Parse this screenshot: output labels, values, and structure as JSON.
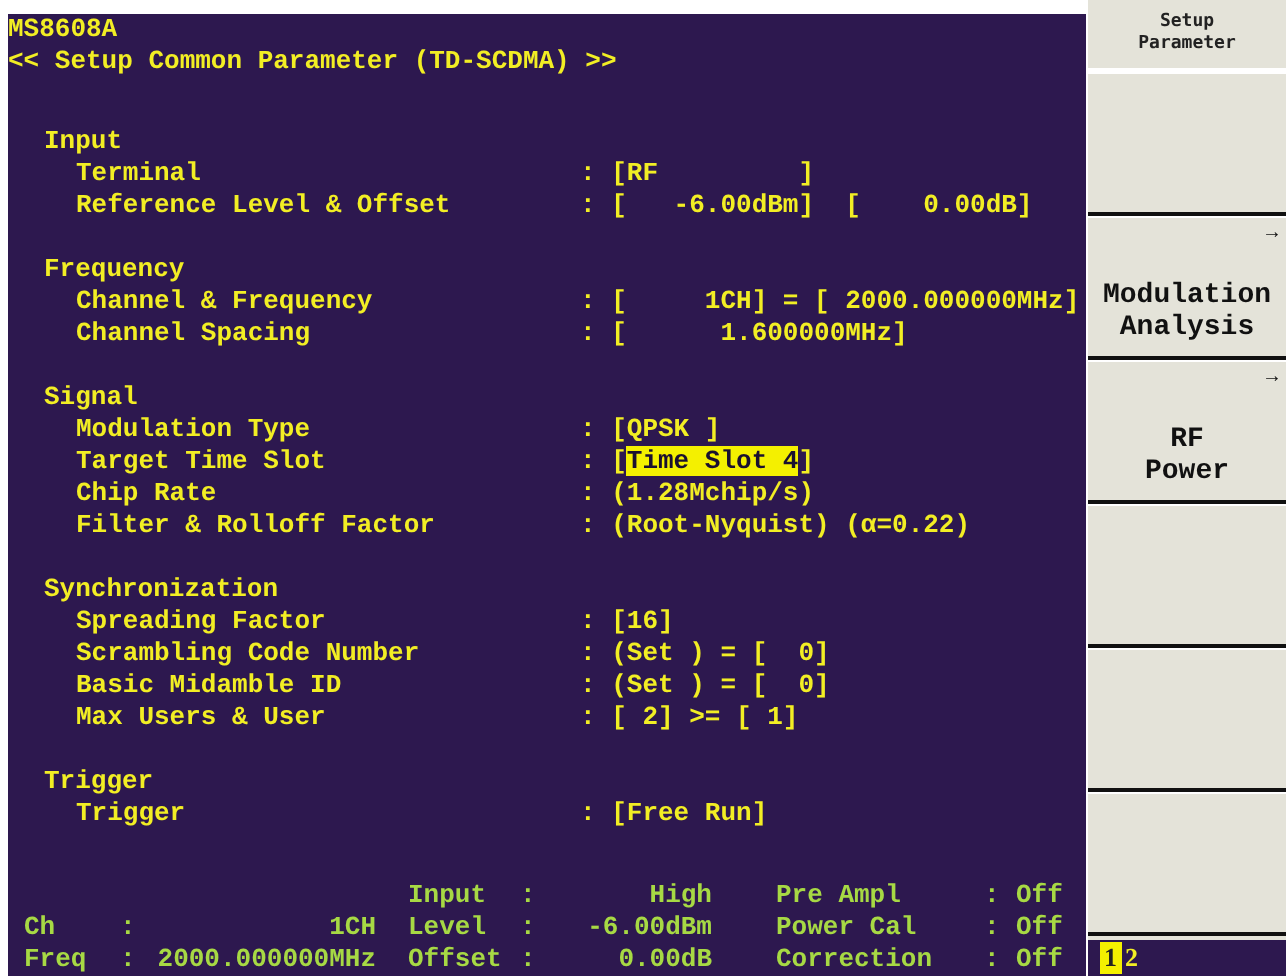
{
  "screen": {
    "model": "MS8608A",
    "title": "<< Setup Common Parameter (TD-SCDMA) >>"
  },
  "sections": [
    {
      "title": "Input",
      "rows": [
        {
          "label": "Terminal",
          "value": [
            {
              "text": ": [RF         ]",
              "selected": false
            }
          ]
        },
        {
          "label": "Reference Level & Offset",
          "value": [
            {
              "text": ": [   -6.00dBm]  [    0.00dB]",
              "selected": false
            }
          ]
        }
      ]
    },
    {
      "title": "Frequency",
      "rows": [
        {
          "label": "Channel & Frequency",
          "value": [
            {
              "text": ": [     1CH] = [ 2000.000000MHz]",
              "selected": false
            }
          ]
        },
        {
          "label": "Channel Spacing",
          "value": [
            {
              "text": ": [      1.600000MHz]",
              "selected": false
            }
          ]
        }
      ]
    },
    {
      "title": "Signal",
      "rows": [
        {
          "label": "Modulation Type",
          "value": [
            {
              "text": ": [QPSK ]",
              "selected": false
            }
          ]
        },
        {
          "label": "Target Time Slot",
          "value": [
            {
              "text": ": [",
              "selected": false
            },
            {
              "text": "Time Slot 4",
              "selected": true
            },
            {
              "text": "]",
              "selected": false
            }
          ]
        },
        {
          "label": "Chip Rate",
          "value": [
            {
              "text": ": (1.28Mchip/s)",
              "selected": false
            }
          ]
        },
        {
          "label": "Filter & Rolloff Factor",
          "value": [
            {
              "text": ": (Root-Nyquist) (α=0.22)",
              "selected": false
            }
          ]
        }
      ]
    },
    {
      "title": "Synchronization",
      "rows": [
        {
          "label": "Spreading Factor",
          "value": [
            {
              "text": ": [16]",
              "selected": false
            }
          ]
        },
        {
          "label": "Scrambling Code Number",
          "value": [
            {
              "text": ": (Set ) = [  0]",
              "selected": false
            }
          ]
        },
        {
          "label": "Basic Midamble ID",
          "value": [
            {
              "text": ": (Set ) = [  0]",
              "selected": false
            }
          ]
        },
        {
          "label": "Max Users & User",
          "value": [
            {
              "text": ": [ 2] >= [ 1]",
              "selected": false
            }
          ]
        }
      ]
    },
    {
      "title": "Trigger",
      "rows": [
        {
          "label": "Trigger",
          "value": [
            {
              "text": ": [Free Run]",
              "selected": false
            }
          ]
        }
      ]
    }
  ],
  "status": [
    [
      {
        "label": "Ch",
        "sep": ":",
        "value": "1CH"
      },
      {
        "label": "Freq",
        "sep": ":",
        "value": "2000.000000MHz"
      }
    ],
    [
      {
        "label": "Input",
        "sep": ":",
        "value": "High"
      },
      {
        "label": "Level",
        "sep": ":",
        "value": "-6.00dBm"
      },
      {
        "label": "Offset",
        "sep": ":",
        "value": "0.00dB"
      }
    ],
    [
      {
        "label": "Pre Ampl",
        "sep": ":",
        "value": "Off"
      },
      {
        "label": "Power Cal",
        "sep": ":",
        "value": "Off"
      },
      {
        "label": "Correction",
        "sep": ":",
        "value": "Off"
      }
    ]
  ],
  "softkeys": {
    "header": "Setup Parameter",
    "keys": [
      {
        "kind": "blank"
      },
      {
        "kind": "menu",
        "lines": [
          "Modulation",
          "Analysis"
        ],
        "arrow": "→"
      },
      {
        "kind": "menu",
        "lines": [
          "RF",
          "Power"
        ],
        "arrow": "→"
      },
      {
        "kind": "blank"
      },
      {
        "kind": "blank"
      },
      {
        "kind": "blank"
      }
    ],
    "pages": [
      {
        "label": "1",
        "selected": true
      },
      {
        "label": "2",
        "selected": false
      }
    ]
  }
}
